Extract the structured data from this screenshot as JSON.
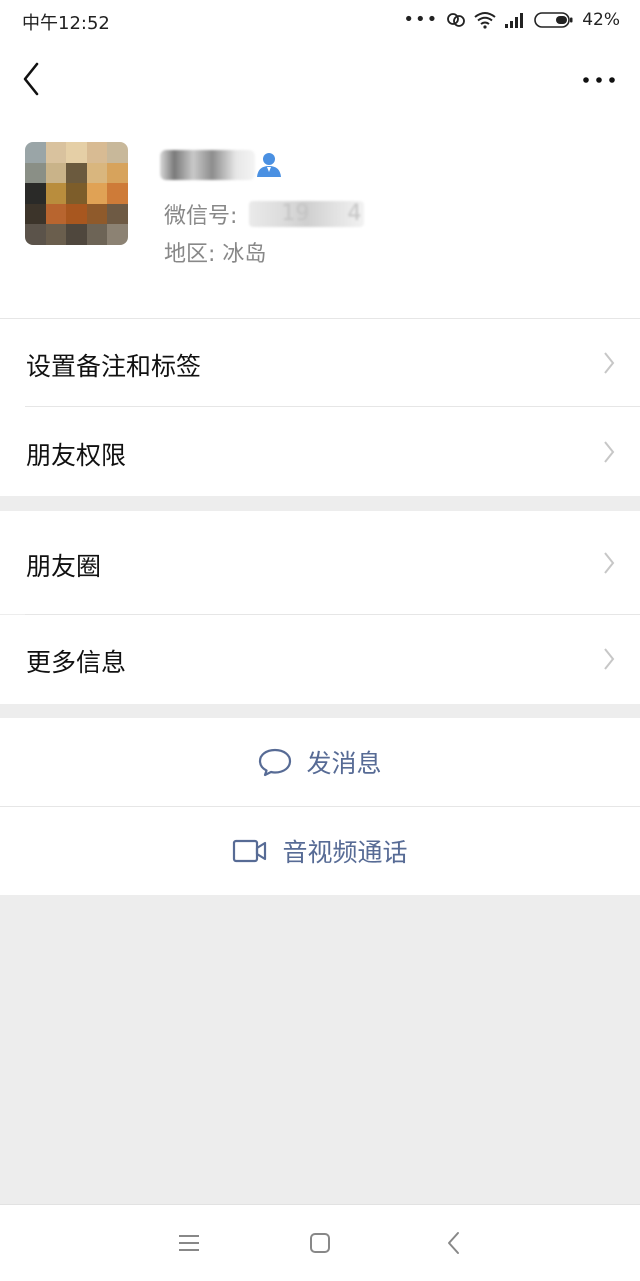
{
  "status_bar": {
    "time": "中午12:52",
    "battery": "42%",
    "icons": [
      "more-dots-icon",
      "link-icon",
      "wifi-icon",
      "signal-icon",
      "battery-icon"
    ]
  },
  "nav": {
    "back_icon": "chevron-left-icon",
    "more_icon": "more-dots-icon"
  },
  "profile": {
    "wechat_id_label": "微信号:",
    "wechat_id_fragment_1": "19",
    "wechat_id_fragment_2": "4",
    "region": "地区: 冰岛",
    "contact_icon": "contact-person-icon"
  },
  "menu": {
    "section1": [
      "设置备注和标签",
      "朋友权限"
    ],
    "section2": [
      "朋友圈",
      "更多信息"
    ]
  },
  "actions": {
    "message": "发消息",
    "message_icon": "chat-bubble-icon",
    "call": "音视频通话",
    "call_icon": "video-camera-icon"
  },
  "system_nav": [
    "menu-icon",
    "home-square-icon",
    "back-arrow-icon"
  ],
  "colors": {
    "link_blue": "#576b95",
    "background": "#ededed",
    "contact_icon_blue": "#4a90e2"
  }
}
